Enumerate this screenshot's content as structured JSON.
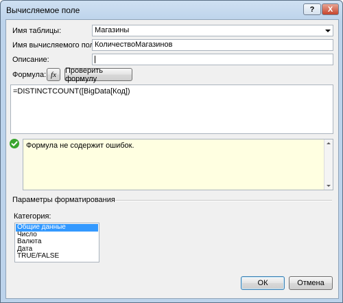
{
  "window": {
    "title": "Вычисляемое поле",
    "help_label": "?",
    "close_label": "X"
  },
  "form": {
    "table_label": "Имя таблицы:",
    "table_value": "Магазины",
    "field_name_label": "Имя вычисляемого поля:",
    "field_name_value": "КоличествоМагазинов",
    "description_label": "Описание:",
    "description_value": "",
    "formula_label": "Формула:",
    "fx_label": "fx",
    "check_formula_label": "Проверить формулу",
    "formula_text": "=DISTINCTCOUNT([BigData[Код])",
    "status_text": "Формула не содержит ошибок."
  },
  "formatting": {
    "section_title": "Параметры форматирования",
    "category_label": "Категория:",
    "categories": [
      "Общие данные",
      "Число",
      "Валюта",
      "Дата",
      "TRUE/FALSE"
    ],
    "selected_index": 0
  },
  "buttons": {
    "ok_label": "ОК",
    "cancel_label": "Отмена"
  },
  "colors": {
    "selection": "#3399ff",
    "status_bg": "#ffffe1",
    "success_icon": "#3aa52f"
  }
}
